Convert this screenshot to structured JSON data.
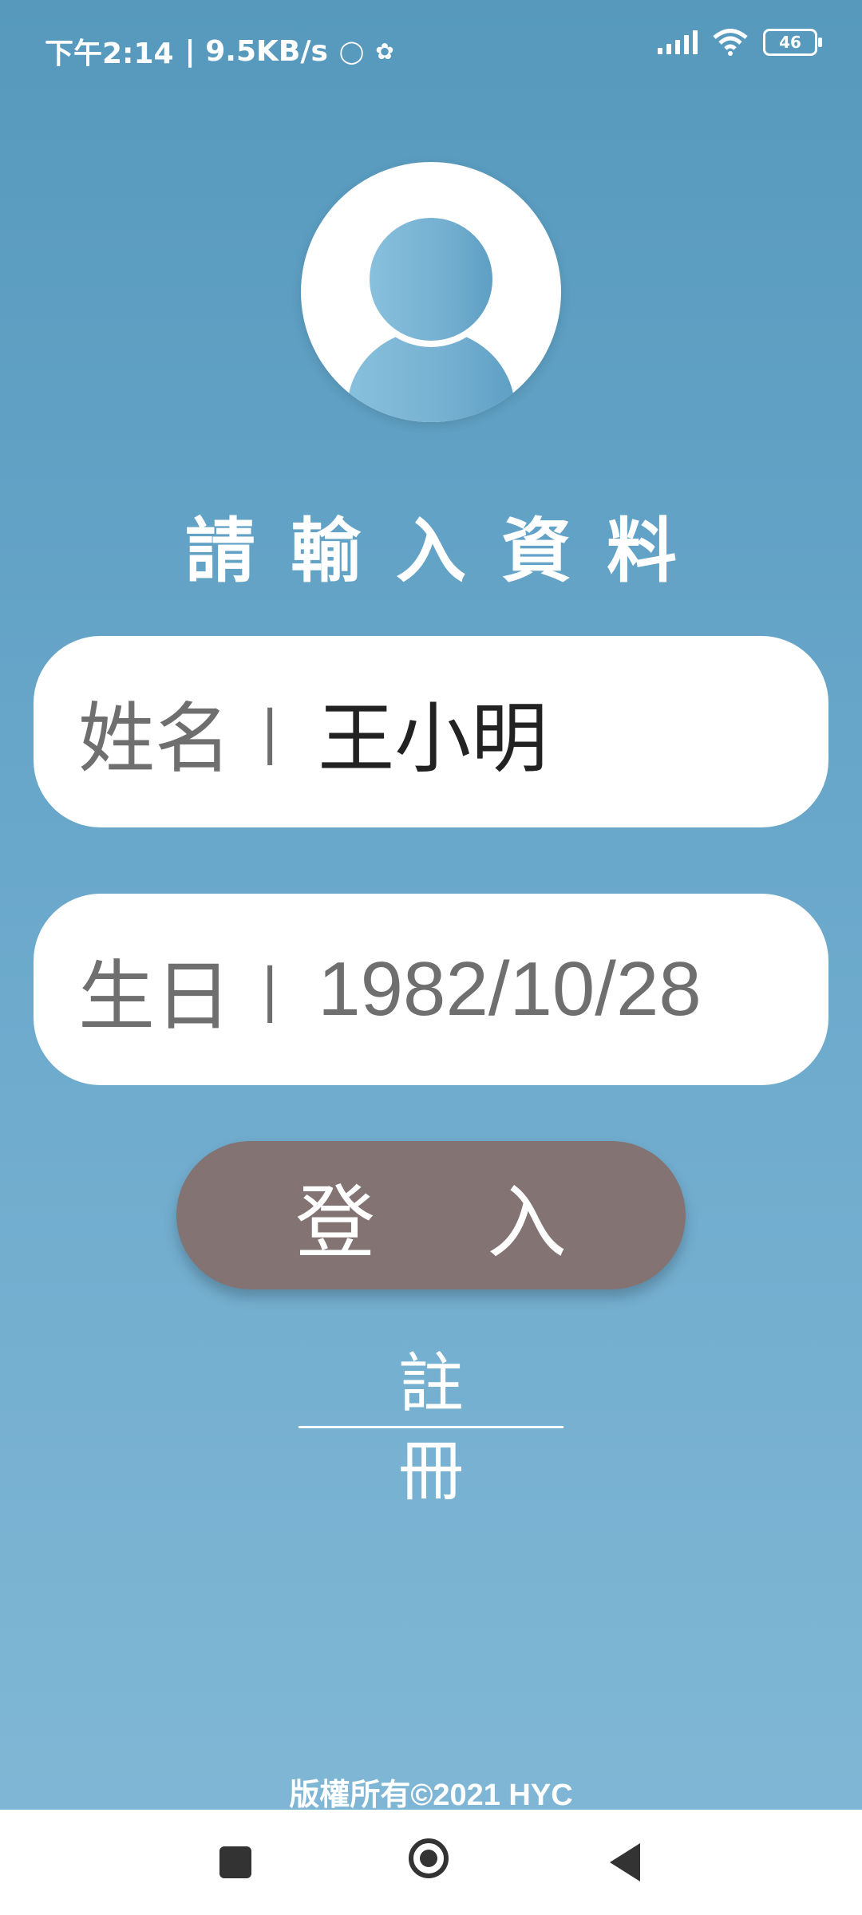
{
  "status_bar": {
    "time": "下午2:14",
    "speed": "| 9.5KB/s",
    "battery": "46"
  },
  "header": {
    "title": "請輸入資料"
  },
  "form": {
    "name": {
      "label": "姓名",
      "separator": "|",
      "value": "王小明"
    },
    "birthday": {
      "label": "生日",
      "separator": "|",
      "value": "1982/10/28"
    }
  },
  "actions": {
    "login_label": "登入",
    "register_label": "註冊"
  },
  "footer": {
    "copyright": "版權所有©2021 HYC"
  },
  "colors": {
    "background_top": "#5699bd",
    "background_bottom": "#82b8d6",
    "login_button": "#847373"
  }
}
